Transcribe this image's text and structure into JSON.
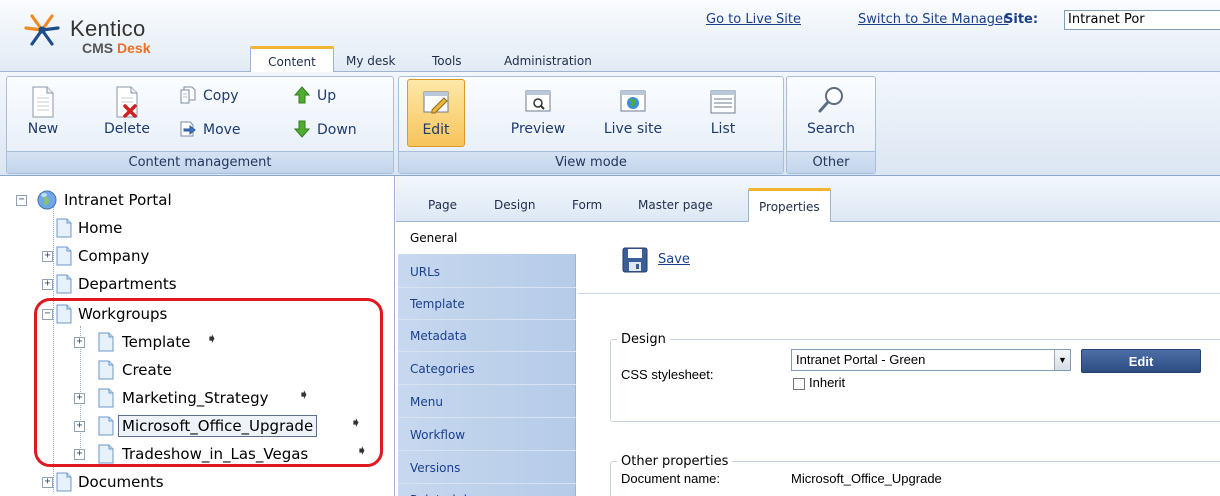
{
  "header": {
    "logo_name": "Kentico",
    "logo_product": "CMS",
    "logo_desk": "Desk",
    "go_live": "Go to Live Site",
    "switch_site_manager": "Switch to Site Manager",
    "site_label": "Site:",
    "site_value": "Intranet Por"
  },
  "main_tabs": [
    {
      "label": "Content",
      "active": true
    },
    {
      "label": "My desk"
    },
    {
      "label": "Tools"
    },
    {
      "label": "Administration"
    }
  ],
  "toolbar": {
    "content_management": {
      "caption": "Content management",
      "new": "New",
      "delete": "Delete",
      "copy": "Copy",
      "move": "Move",
      "up": "Up",
      "down": "Down"
    },
    "view_mode": {
      "caption": "View mode",
      "edit": "Edit",
      "preview": "Preview",
      "live_site": "Live site",
      "list": "List"
    },
    "other": {
      "caption": "Other",
      "search": "Search"
    }
  },
  "tree": {
    "root": "Intranet Portal",
    "items": [
      {
        "label": "Home"
      },
      {
        "label": "Company"
      },
      {
        "label": "Departments"
      },
      {
        "label": "Workgroups"
      },
      {
        "label": "Template"
      },
      {
        "label": "Create"
      },
      {
        "label": "Marketing_Strategy"
      },
      {
        "label": "Microsoft_Office_Upgrade",
        "selected": true
      },
      {
        "label": "Tradeshow_in_Las_Vegas"
      },
      {
        "label": "Documents"
      }
    ]
  },
  "page_tabs": [
    {
      "label": "Page"
    },
    {
      "label": "Design"
    },
    {
      "label": "Form"
    },
    {
      "label": "Master page"
    },
    {
      "label": "Properties",
      "active": true
    }
  ],
  "side_menu": [
    {
      "label": "General",
      "active": true
    },
    {
      "label": "URLs"
    },
    {
      "label": "Template"
    },
    {
      "label": "Metadata"
    },
    {
      "label": "Categories"
    },
    {
      "label": "Menu"
    },
    {
      "label": "Workflow"
    },
    {
      "label": "Versions"
    },
    {
      "label": "Related docs"
    }
  ],
  "content": {
    "save": "Save",
    "design_legend": "Design",
    "css_label": "CSS stylesheet:",
    "css_value": "Intranet Portal - Green",
    "edit_button": "Edit",
    "inherit_label": "Inherit",
    "other_legend": "Other properties",
    "doc_name_label": "Document name:",
    "doc_name_value": "Microsoft_Office_Upgrade"
  },
  "colors": {
    "accent_tab": "#f2b532",
    "link": "#1a3f8c",
    "highlight": "#e0181f"
  }
}
